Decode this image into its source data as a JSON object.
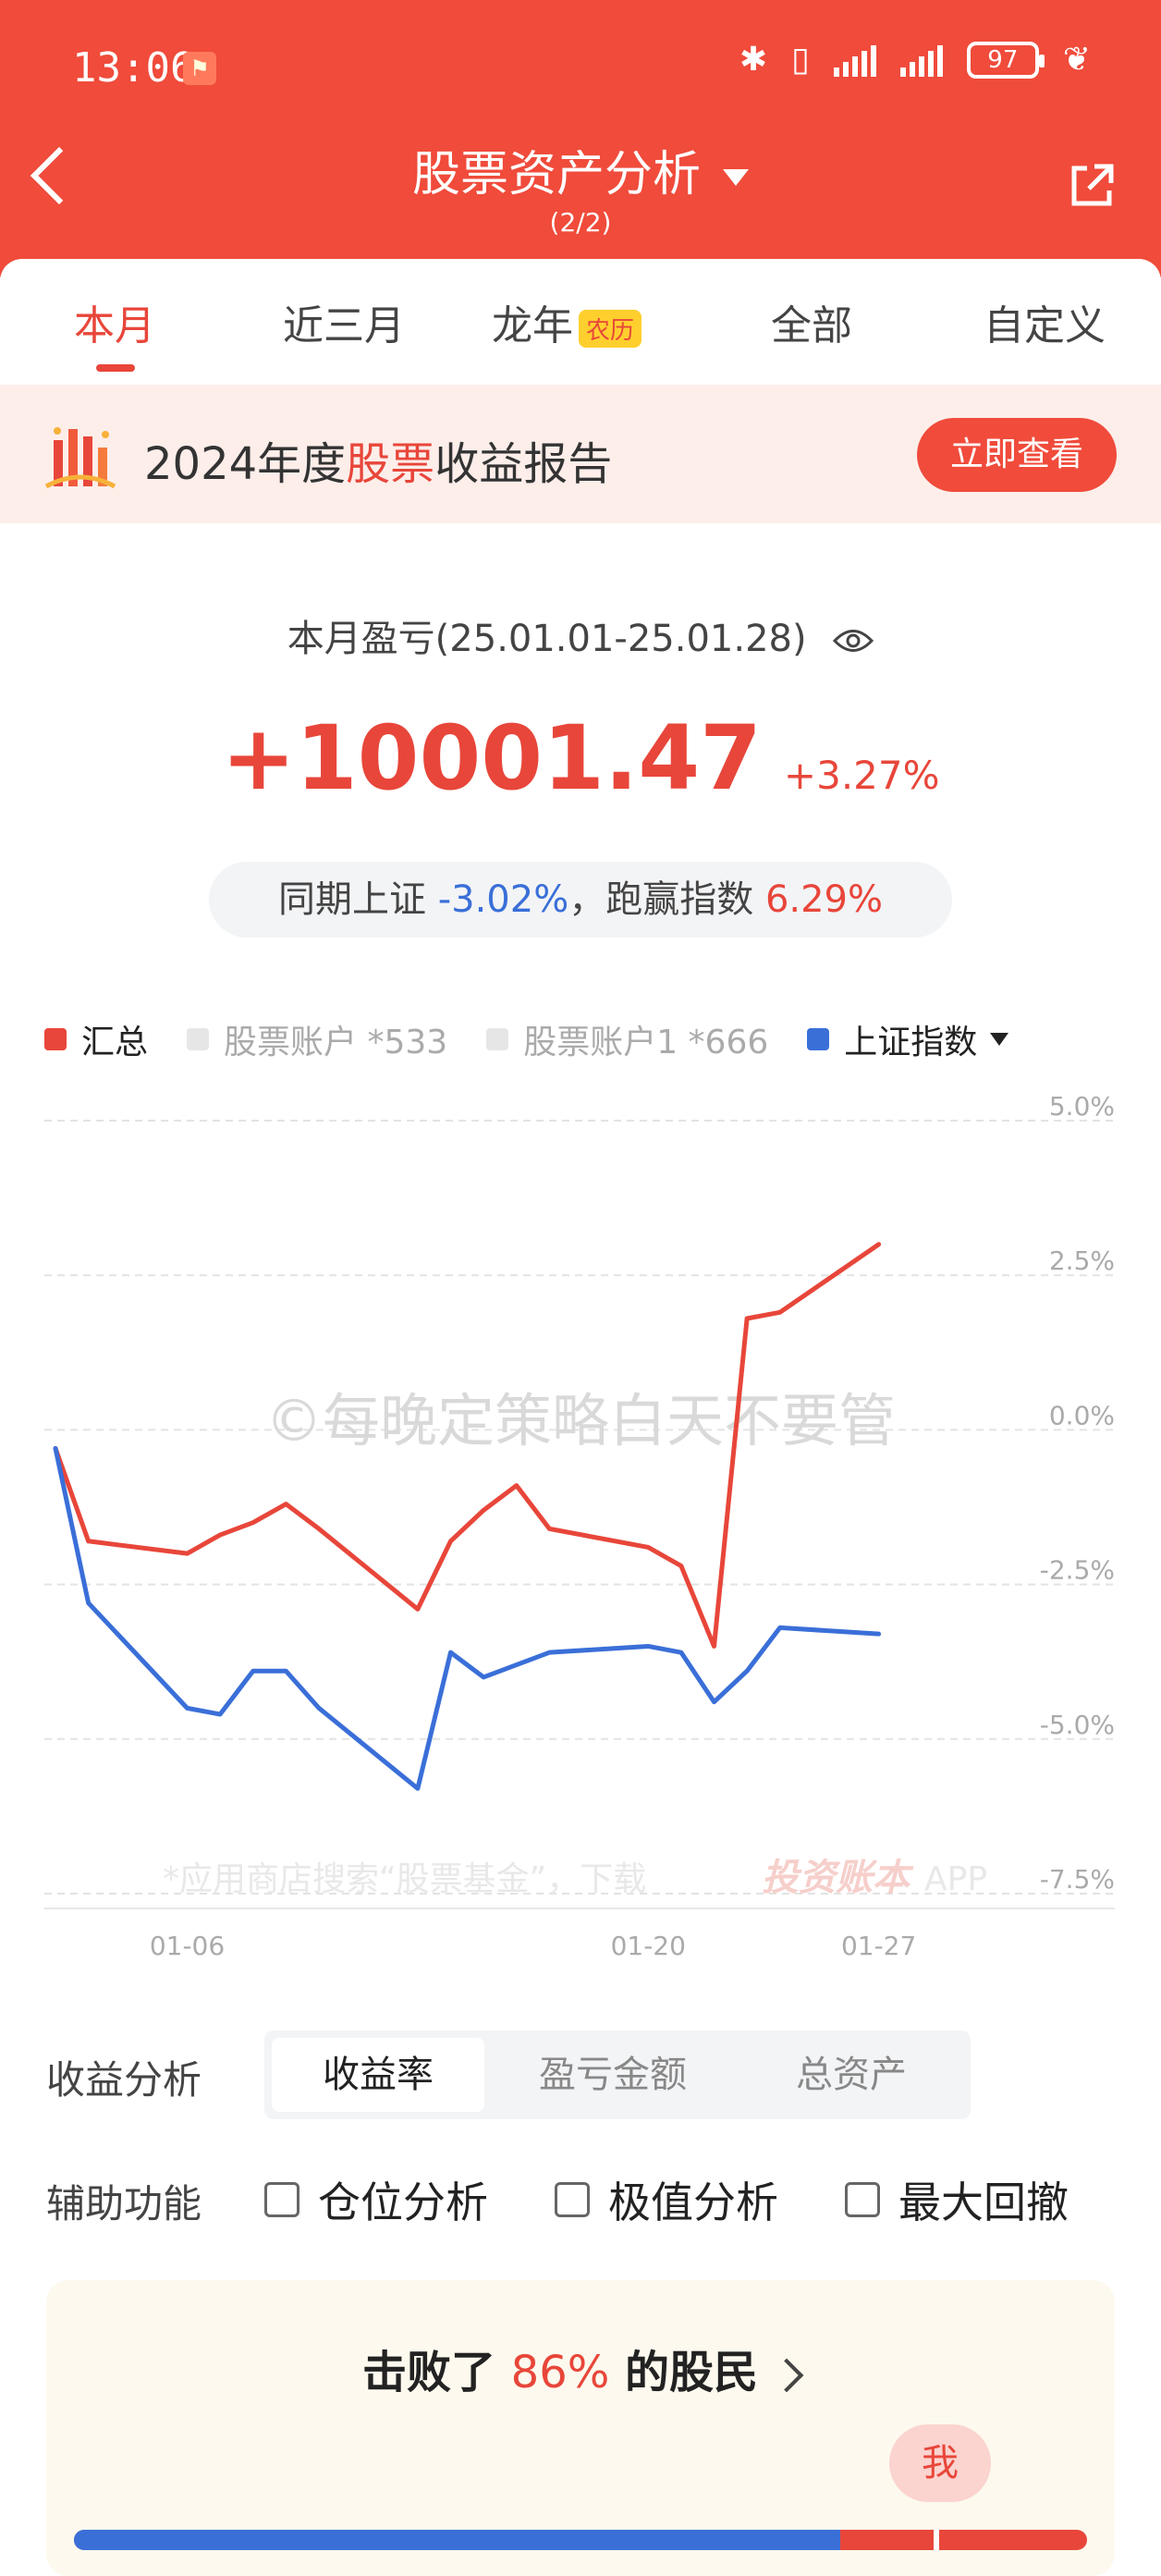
{
  "status": {
    "time": "13:06",
    "battery": "97"
  },
  "header": {
    "title": "股票资产分析",
    "page": "(2/2)"
  },
  "tabs": [
    {
      "label": "本月",
      "active": true
    },
    {
      "label": "近三月"
    },
    {
      "label": "龙年",
      "badge": "农历"
    },
    {
      "label": "全部"
    },
    {
      "label": "自定义"
    }
  ],
  "banner": {
    "pre": "2024年度",
    "highlight": "股票",
    "post": "收益报告",
    "button": "立即查看"
  },
  "summary": {
    "period": "本月盈亏(25.01.01-25.01.28)",
    "amount": "+10001.47",
    "percent": "+3.27%",
    "compare_prefix": "同期上证",
    "index_change": "-3.02%",
    "compare_mid": "，跑赢指数",
    "outperform": "6.29%"
  },
  "legend": [
    {
      "label": "汇总",
      "color": "#e8463a"
    },
    {
      "label": "股票账户 *533",
      "color": "#e6e6e6",
      "muted": true
    },
    {
      "label": "股票账户1 *666",
      "color": "#e6e6e6",
      "muted": true
    },
    {
      "label": "上证指数",
      "color": "#3a6fd8",
      "dropdown": true
    }
  ],
  "watermark": "©每晚定策略白天不要管",
  "promo_text": "*应用商店搜索“股票基金”，下载",
  "promo_brand": "投资账本",
  "promo_app": "APP",
  "chart_data": {
    "type": "line",
    "y_ticks": [
      "5.0%",
      "2.5%",
      "0.0%",
      "-2.5%",
      "-5.0%",
      "-7.5%"
    ],
    "ylim": [
      -7.5,
      5.0
    ],
    "x_ticks": [
      {
        "label": "01-06",
        "day": 6
      },
      {
        "label": "01-20",
        "day": 20
      },
      {
        "label": "01-27",
        "day": 27
      }
    ],
    "x": [
      2,
      3,
      6,
      7,
      8,
      9,
      10,
      13,
      14,
      15,
      16,
      17,
      20,
      21,
      22,
      23,
      24,
      27
    ],
    "series": [
      {
        "name": "汇总",
        "color": "#e8463a",
        "values": [
          -0.3,
          -1.8,
          -2.0,
          -1.7,
          -1.5,
          -1.2,
          -1.6,
          -2.9,
          -1.8,
          -1.3,
          -0.9,
          -1.6,
          -1.9,
          -2.2,
          -3.5,
          1.8,
          1.9,
          3.0
        ]
      },
      {
        "name": "上证指数",
        "color": "#3a6fd8",
        "values": [
          -0.3,
          -2.8,
          -4.5,
          -4.6,
          -3.9,
          -3.9,
          -4.5,
          -5.8,
          -3.6,
          -4.0,
          -3.8,
          -3.6,
          -3.5,
          -3.6,
          -4.4,
          -3.9,
          -3.2,
          -3.3
        ]
      }
    ]
  },
  "analysis": {
    "label": "收益分析",
    "options": [
      "收益率",
      "盈亏金额",
      "总资产"
    ],
    "active": 0
  },
  "aux": {
    "label": "辅助功能",
    "options": [
      "仓位分析",
      "极值分析",
      "最大回撤"
    ]
  },
  "beat": {
    "pre": "击败了 ",
    "percent": "86%",
    "post": " 的股民",
    "me": "我",
    "progress": 0.86
  }
}
